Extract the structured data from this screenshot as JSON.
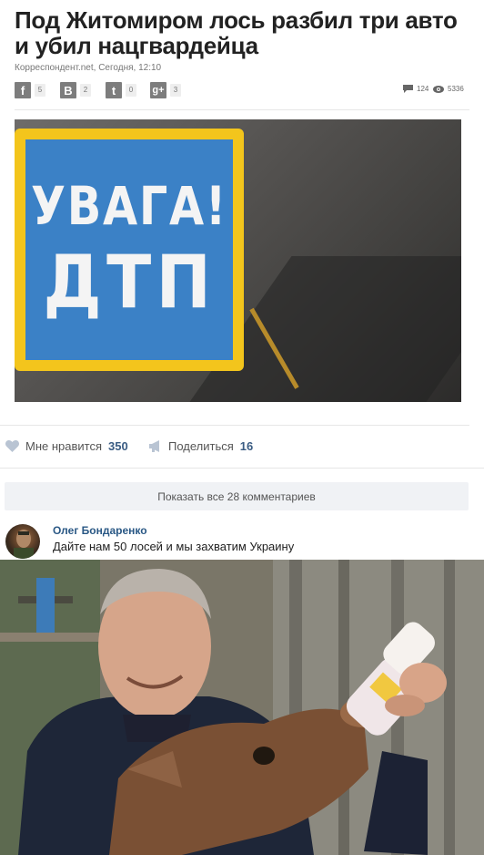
{
  "article": {
    "headline": "Под Житомиром лось разбил три авто и убил нацгвардейца",
    "meta": "Корреспондент.net, Сегодня, 12:10",
    "share": [
      {
        "icon": "facebook-icon",
        "glyph": "f",
        "count": "5"
      },
      {
        "icon": "vkontakte-icon",
        "glyph": "В",
        "count": "2"
      },
      {
        "icon": "twitter-icon",
        "glyph": "t",
        "count": "0"
      },
      {
        "icon": "google-plus-icon",
        "glyph": "g+",
        "count": "3"
      }
    ],
    "comments_count": "124",
    "views_count": "5336",
    "photo": {
      "line1": "УВАГА!",
      "line2": "ДТП"
    }
  },
  "actions": {
    "like_label": "Мне нравится",
    "like_count": "350",
    "share_label": "Поделиться",
    "share_count": "16"
  },
  "comments": {
    "show_all": "Показать все 28 комментариев",
    "items": [
      {
        "author": "Олег Бондаренко",
        "text": "Дайте нам 50 лосей и мы захватим Украину"
      }
    ]
  },
  "colors": {
    "link": "#2a5885",
    "sign_yellow": "#f3c51c",
    "sign_blue": "#3b81c6"
  }
}
